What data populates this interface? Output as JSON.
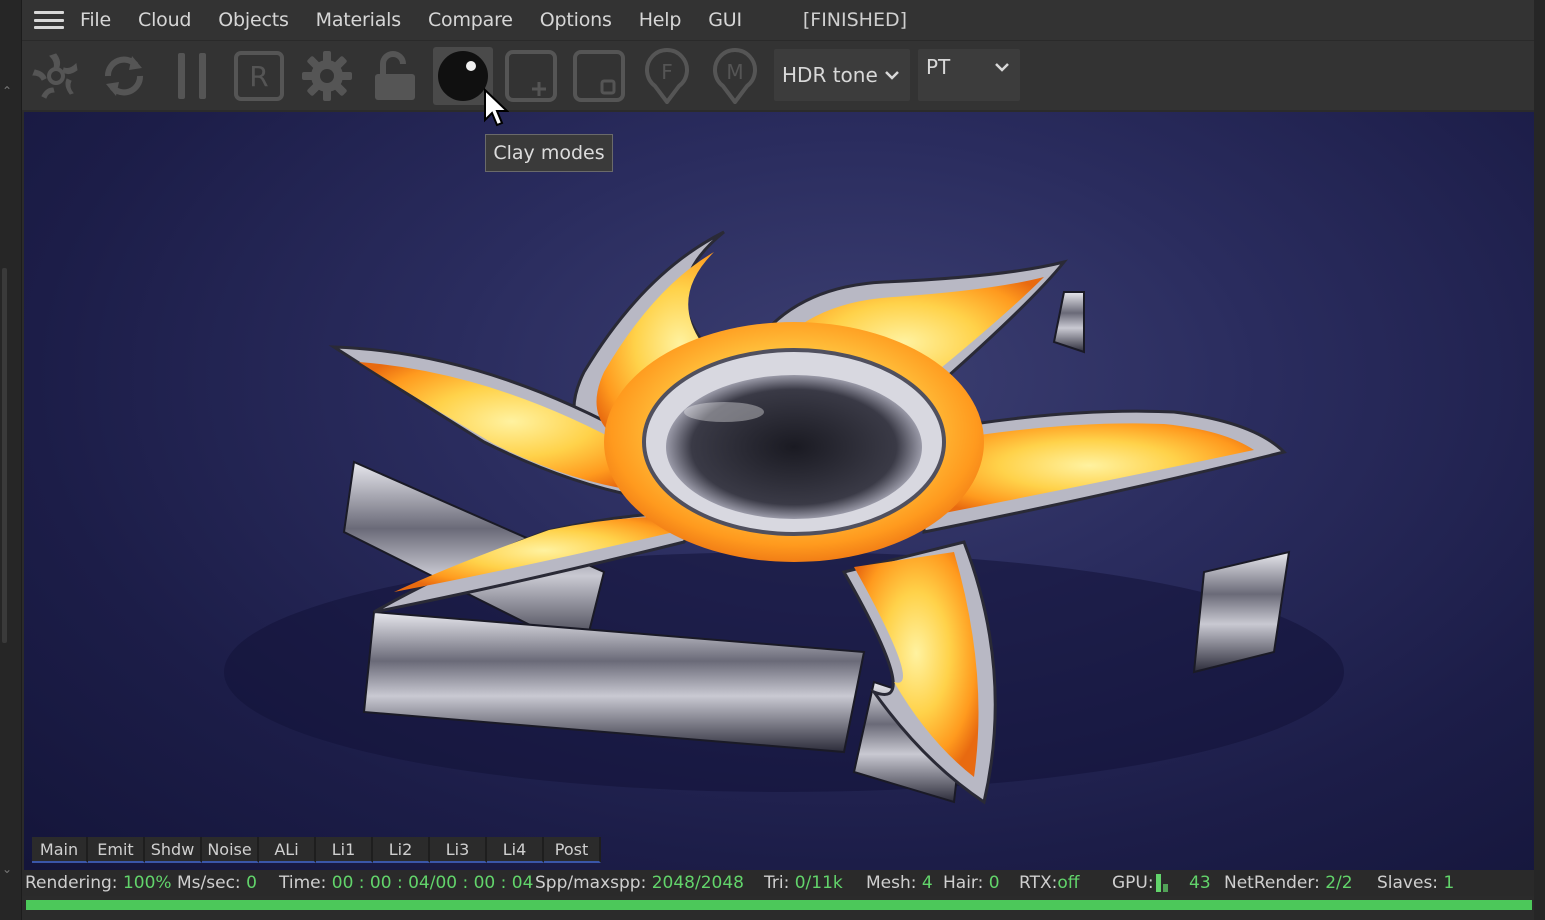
{
  "menu": {
    "items": [
      "File",
      "Cloud",
      "Objects",
      "Materials",
      "Compare",
      "Options",
      "Help",
      "GUI"
    ],
    "status": "[FINISHED]"
  },
  "toolbar": {
    "buttons": [
      {
        "icon": "octane-logo-icon"
      },
      {
        "icon": "restart-render-icon"
      },
      {
        "icon": "pause-icon"
      },
      {
        "icon": "region-render-icon",
        "glyph": "R"
      },
      {
        "icon": "settings-gear-icon"
      },
      {
        "icon": "lock-icon"
      },
      {
        "icon": "clay-mode-sphere-icon",
        "active": true
      },
      {
        "icon": "add-pick-icon",
        "glyph": "+"
      },
      {
        "icon": "pick-square-icon"
      },
      {
        "icon": "focus-pick-icon",
        "glyph": "F"
      },
      {
        "icon": "material-pick-icon",
        "glyph": "M"
      }
    ],
    "hdr_dropdown": "HDR tone",
    "kernel_dropdown": "PT"
  },
  "tooltip": "Clay modes",
  "pass_tabs": [
    "Main",
    "Emit",
    "Shdw",
    "Noise",
    "ALi",
    "Li1",
    "Li2",
    "Li3",
    "Li4",
    "Post"
  ],
  "status": {
    "rendering_label": "Rendering:",
    "rendering_value": "100%",
    "mssec_label": "Ms/sec:",
    "mssec_value": "0",
    "time_label": "Time:",
    "time_value": "00 : 00 : 04/00 : 00 : 04",
    "spp_label": "Spp/maxspp:",
    "spp_value": "2048/2048",
    "tri_label": "Tri:",
    "tri_value": "0/11k",
    "mesh_label": "Mesh:",
    "mesh_value": "4",
    "hair_label": "Hair:",
    "hair_value": "0",
    "rtx_label": "RTX:",
    "rtx_value": "off",
    "gpu_label": "GPU:",
    "gpu_value": "43",
    "netrender_label": "NetRender:",
    "netrender_value": "2/2",
    "slaves_label": "Slaves:",
    "slaves_value": "1"
  },
  "progress": 1.0,
  "colors": {
    "accent_green": "#62d46b",
    "progress_green": "#4cc85a",
    "viewport_blue": "#2a2c5e",
    "tab_underline": "#3a56a8"
  }
}
